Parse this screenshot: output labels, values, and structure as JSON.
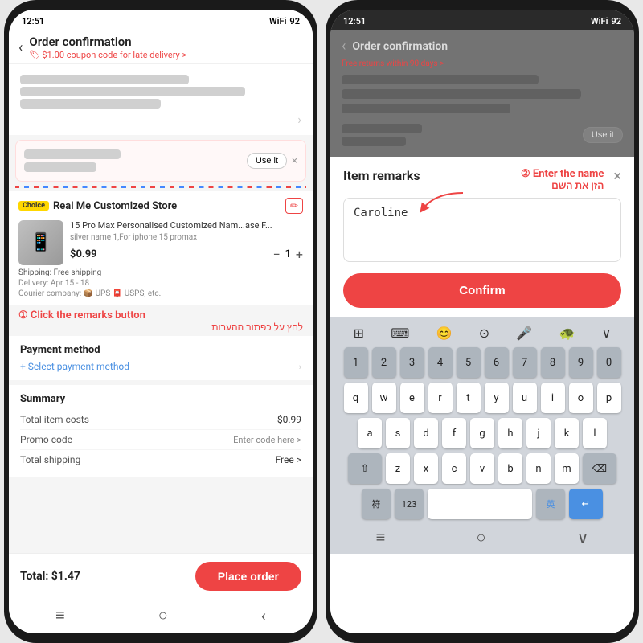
{
  "left_phone": {
    "status": {
      "time": "12:51",
      "wifi": "WiFi",
      "battery": "92"
    },
    "header": {
      "title": "Order confirmation",
      "subtitle": "$1.00 coupon code for late delivery >"
    },
    "coupon_banner": {
      "text": "████ ██████ ███████ ██",
      "use_it": "Use it",
      "close": "×"
    },
    "store": {
      "choice": "Choice",
      "name": "Real Me Customized Store",
      "product_name": "15 Pro Max Personalised Customized Nam...ase F...",
      "product_variant": "silver name 1,For iphone 15 promax",
      "price": "$0.99",
      "qty": "1",
      "shipping": "Shipping: Free shipping",
      "delivery": "Delivery: Apr 15 - 18",
      "courier": "Courier company: 📦 UPS 📮 USPS, etc."
    },
    "annotation1_en": "① Click the remarks button",
    "annotation1_he": "לחץ על כפתור ההערות",
    "payment": {
      "title": "Payment method",
      "link": "+ Select payment method"
    },
    "summary": {
      "title": "Summary",
      "item_costs_label": "Total item costs",
      "item_costs_value": "$0.99",
      "promo_label": "Promo code",
      "promo_value": "Enter code here >",
      "shipping_label": "Total shipping",
      "shipping_value": "Free >"
    },
    "bottom": {
      "total": "Total:  $1.47",
      "place_order": "Place order"
    },
    "nav": [
      "≡",
      "○",
      "<"
    ]
  },
  "right_phone": {
    "status": {
      "time": "12:51",
      "wifi": "WiFi",
      "battery": "92"
    },
    "header": {
      "title": "Order confirmation",
      "subtitle": "Free returns within 90 days >"
    },
    "modal": {
      "title": "Item remarks",
      "annotation_en": "② Enter the name",
      "annotation_he": "הזן את השם",
      "close": "×",
      "input_value": "Caroline",
      "confirm": "Confirm"
    },
    "keyboard": {
      "toolbar": [
        "⊞",
        "⌨",
        "😊",
        "⊙",
        "🎤",
        "🐢",
        "∨"
      ],
      "row1": [
        "1",
        "2",
        "3",
        "4",
        "5",
        "6",
        "7",
        "8",
        "9",
        "0"
      ],
      "row2": [
        "q",
        "w",
        "e",
        "r",
        "t",
        "y",
        "u",
        "i",
        "o",
        "p"
      ],
      "row3": [
        "a",
        "s",
        "d",
        "f",
        "g",
        "h",
        "j",
        "k",
        "l"
      ],
      "row4_l": "⇧",
      "row4": [
        "z",
        "x",
        "c",
        "v",
        "b",
        "n",
        "m"
      ],
      "row4_r": "⌫",
      "row5_l1": "符",
      "row5_l2": "123",
      "row5_space": "",
      "row5_r1": "英",
      "row5_return": "↵"
    },
    "nav": [
      "≡",
      "○",
      "∨"
    ]
  }
}
